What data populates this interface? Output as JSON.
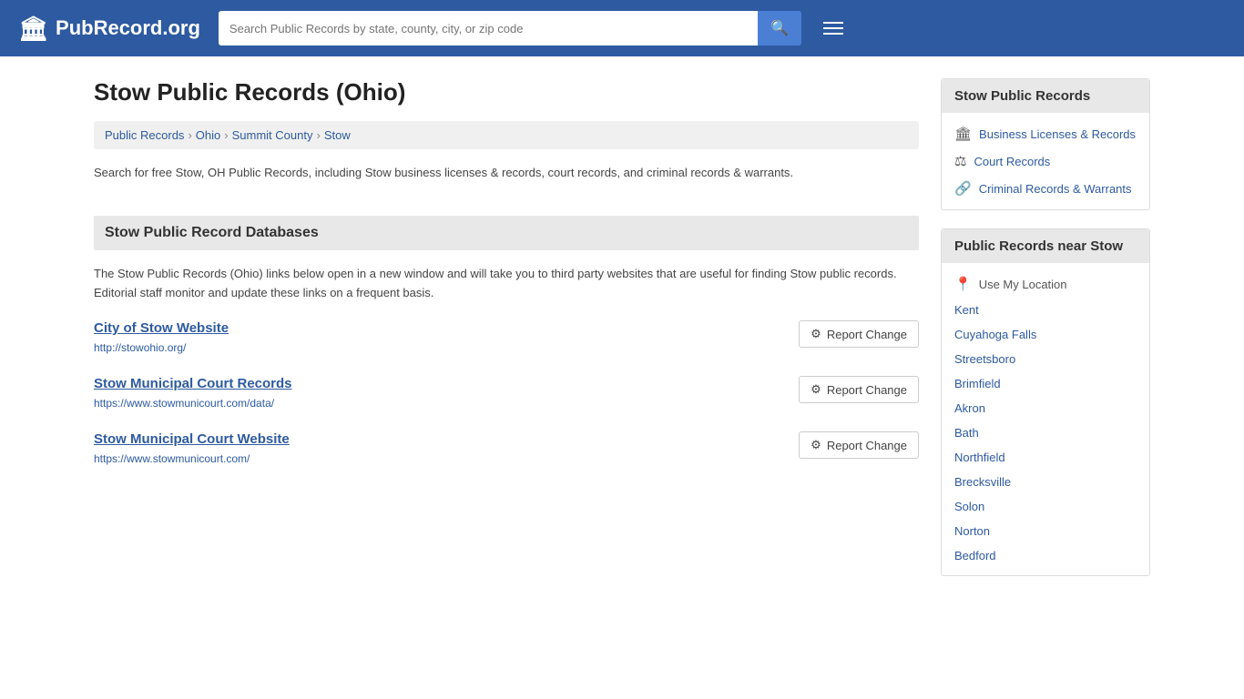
{
  "header": {
    "logo_text": "PubRecord.org",
    "search_placeholder": "Search Public Records by state, county, city, or zip code",
    "search_icon": "🔍",
    "menu_icon": "≡"
  },
  "page": {
    "title": "Stow Public Records (Ohio)",
    "breadcrumb": [
      {
        "label": "Public Records",
        "href": "#"
      },
      {
        "label": "Ohio",
        "href": "#"
      },
      {
        "label": "Summit County",
        "href": "#"
      },
      {
        "label": "Stow",
        "href": "#"
      }
    ],
    "description": "Search for free Stow, OH Public Records, including Stow business licenses & records, court records, and criminal records & warrants.",
    "databases_header": "Stow Public Record Databases",
    "databases_description": "The Stow Public Records (Ohio) links below open in a new window and will take you to third party websites that are useful for finding Stow public records. Editorial staff monitor and update these links on a frequent basis.",
    "records": [
      {
        "title": "City of Stow Website",
        "url": "http://stowohio.org/",
        "report_label": "Report Change"
      },
      {
        "title": "Stow Municipal Court Records",
        "url": "https://www.stowmunicourt.com/data/",
        "report_label": "Report Change"
      },
      {
        "title": "Stow Municipal Court Website",
        "url": "https://www.stowmunicourt.com/",
        "report_label": "Report Change"
      }
    ]
  },
  "sidebar": {
    "public_records_title": "Stow Public Records",
    "public_records_links": [
      {
        "label": "Business Licenses & Records",
        "icon": "🏛",
        "href": "#"
      },
      {
        "label": "Court Records",
        "icon": "⚖",
        "href": "#"
      },
      {
        "label": "Criminal Records & Warrants",
        "icon": "🔗",
        "href": "#"
      }
    ],
    "nearby_title": "Public Records near Stow",
    "use_my_location": "Use My Location",
    "nearby_places": [
      "Kent",
      "Cuyahoga Falls",
      "Streetsboro",
      "Brimfield",
      "Akron",
      "Bath",
      "Northfield",
      "Brecksville",
      "Solon",
      "Norton",
      "Bedford"
    ]
  }
}
